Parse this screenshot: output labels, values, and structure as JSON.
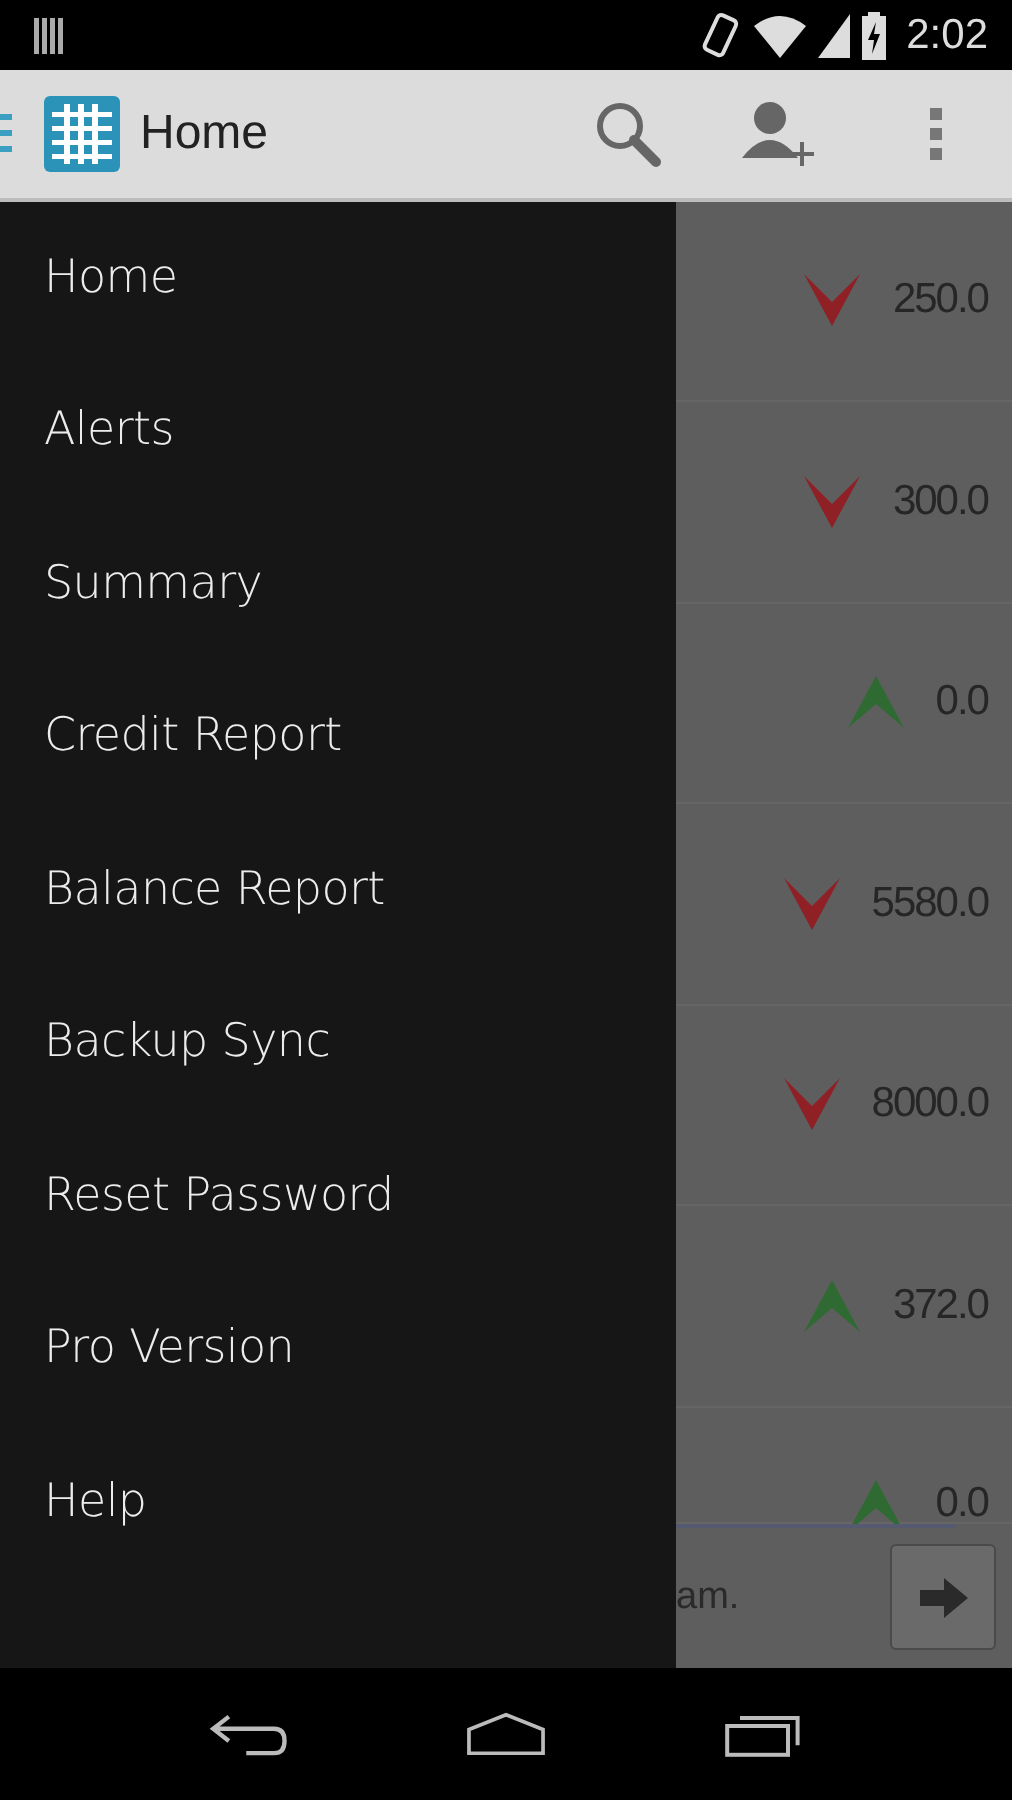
{
  "status_bar": {
    "time": "2:02"
  },
  "action_bar": {
    "title": "Home"
  },
  "drawer": {
    "items": [
      {
        "label": "Home"
      },
      {
        "label": "Alerts"
      },
      {
        "label": "Summary"
      },
      {
        "label": "Credit Report"
      },
      {
        "label": "Balance Report"
      },
      {
        "label": "Backup Sync"
      },
      {
        "label": "Reset Password"
      },
      {
        "label": "Pro Version"
      },
      {
        "label": "Help"
      }
    ]
  },
  "list": {
    "rows": [
      {
        "kind": "down",
        "amount": "250.0"
      },
      {
        "kind": "down",
        "amount": "300.0"
      },
      {
        "kind": "up",
        "amount": "0.0"
      },
      {
        "kind": "down",
        "amount": "5580.0"
      },
      {
        "kind": "down",
        "amount": "8000.0"
      },
      {
        "kind": "up",
        "amount": "372.0"
      },
      {
        "kind": "up",
        "amount": "0.0"
      }
    ]
  },
  "banner": {
    "text": "am."
  }
}
